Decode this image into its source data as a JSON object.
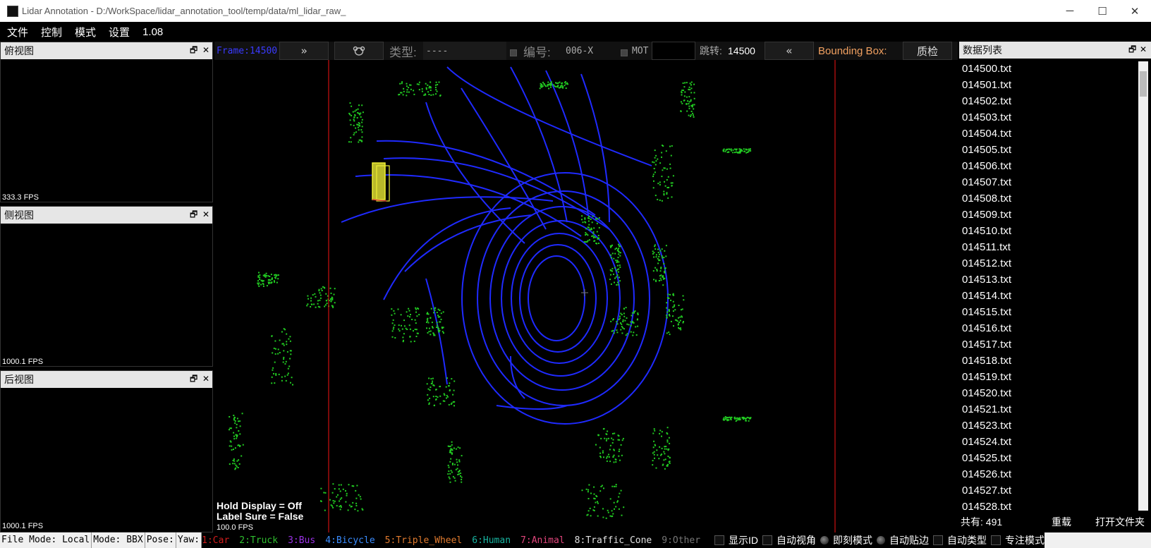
{
  "window": {
    "title": "Lidar Annotation - D:/WorkSpace/lidar_annotation_tool/temp/data/ml_lidar_raw_",
    "controls": [
      "─",
      "☐",
      "✕"
    ]
  },
  "menu": {
    "items": [
      "文件",
      "控制",
      "模式",
      "设置",
      "1.08"
    ]
  },
  "panels": {
    "top": {
      "title": "俯视图",
      "fps": "333.3 FPS"
    },
    "side": {
      "title": "侧视图",
      "fps": "1000.1 FPS"
    },
    "back": {
      "title": "后视图",
      "fps": "1000.1 FPS"
    },
    "float_btn": "🗗",
    "close_btn": "✕"
  },
  "toolbar": {
    "frame": "Frame:14500",
    "next": "»",
    "type_label": "类型:",
    "type_value": "----",
    "id_label": "编号:",
    "id_value": "006-X",
    "mot_label": "MOT",
    "jump_label": "跳转:",
    "jump_value": "14500",
    "prev": "«",
    "bbox_label": "Bounding Box:",
    "qc_button": "质检"
  },
  "viewport": {
    "hold_display": "Hold Display = Off",
    "label_sure": "Label Sure = False",
    "fps": "100.0 FPS"
  },
  "data_list": {
    "title": "数据列表",
    "files": [
      "014500.txt",
      "014501.txt",
      "014502.txt",
      "014503.txt",
      "014504.txt",
      "014505.txt",
      "014506.txt",
      "014507.txt",
      "014508.txt",
      "014509.txt",
      "014510.txt",
      "014511.txt",
      "014512.txt",
      "014513.txt",
      "014514.txt",
      "014515.txt",
      "014516.txt",
      "014517.txt",
      "014518.txt",
      "014519.txt",
      "014520.txt",
      "014521.txt",
      "014523.txt",
      "014524.txt",
      "014525.txt",
      "014526.txt",
      "014527.txt",
      "014528.txt"
    ],
    "total_label": "共有: 491",
    "reload_button": "重载",
    "open_folder_button": "打开文件夹"
  },
  "status": {
    "file_mode": "File Mode: Local",
    "mode": "Mode: BBX",
    "pose": "Pose:",
    "yaw": "Yaw:",
    "categories": [
      {
        "label": "1:Car",
        "color": "#d01c1c"
      },
      {
        "label": "2:Truck",
        "color": "#2fbf2f"
      },
      {
        "label": "3:Bus",
        "color": "#9b32e6"
      },
      {
        "label": "4:Bicycle",
        "color": "#3a8dff"
      },
      {
        "label": "5:Triple_Wheel",
        "color": "#e07a2e"
      },
      {
        "label": "6:Human",
        "color": "#18b4a0"
      },
      {
        "label": "7:Animal",
        "color": "#e0457b"
      },
      {
        "label": "8:Traffic_Cone",
        "color": "#e0e0e0"
      },
      {
        "label": "9:Other",
        "color": "#777777"
      }
    ],
    "options": [
      {
        "label": "显示ID",
        "kind": "checkbox"
      },
      {
        "label": "自动视角",
        "kind": "checkbox"
      },
      {
        "label": "即刻模式",
        "kind": "radio"
      },
      {
        "label": "自动贴边",
        "kind": "radio"
      },
      {
        "label": "自动类型",
        "kind": "checkbox"
      },
      {
        "label": "专注模式",
        "kind": "checkbox"
      }
    ]
  },
  "colors": {
    "points_ground": "#1f2aff",
    "points_object": "#22cc22",
    "boundary": "#cc1111",
    "frame_text": "#3a3aff",
    "bbox_label": "#f0a060"
  }
}
